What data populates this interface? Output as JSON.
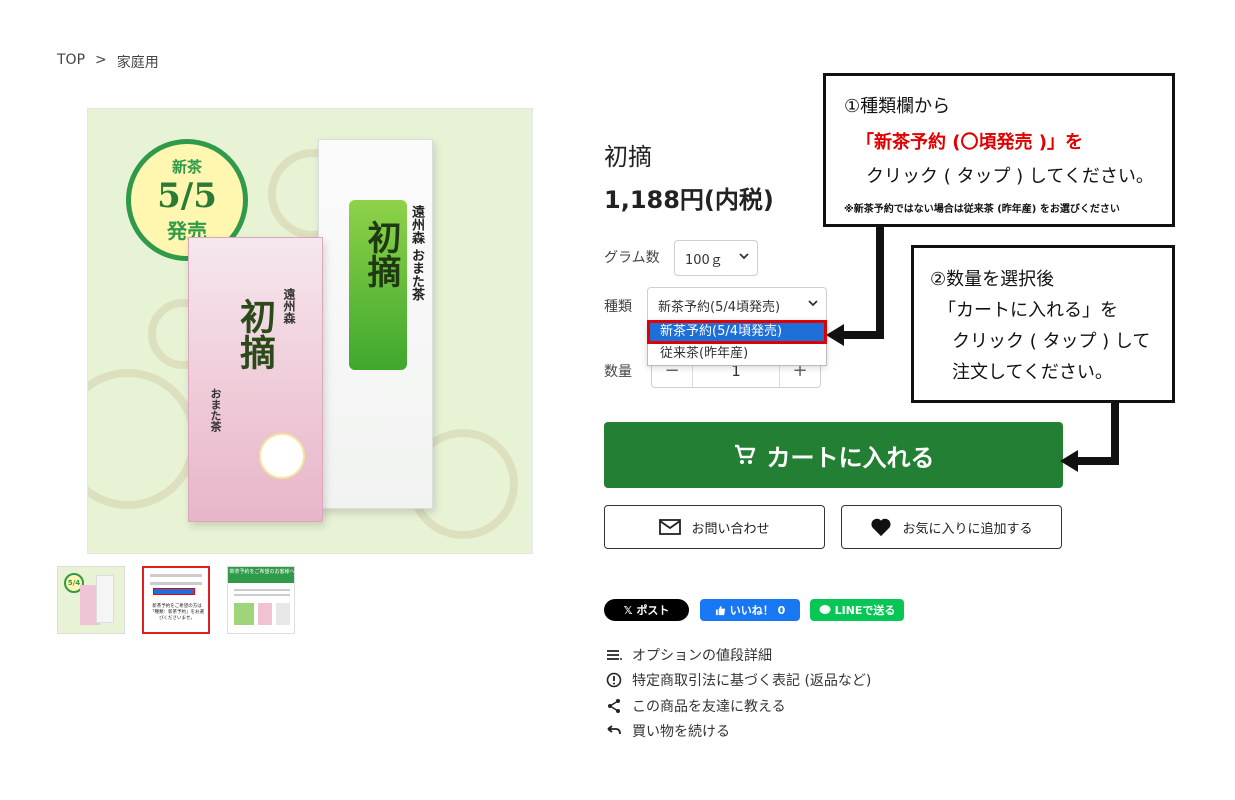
{
  "breadcrumb": {
    "top": "TOP",
    "sep": ">",
    "current": "家庭用"
  },
  "badge": {
    "line1": "新茶",
    "line2": "5/5",
    "line3": "発売"
  },
  "package": {
    "pink_title": "初摘",
    "pink_sub": "遠州森",
    "white_title": "初摘",
    "white_sub": "遠州森 おまた茶",
    "brand": "おまた茶"
  },
  "thumbnails": [
    {
      "label": "product-main",
      "badge": "5/4"
    },
    {
      "label": "order-guide",
      "text": "新茶予約をご希望の方は「種類：新茶予約」をお選びくださいませ。"
    },
    {
      "label": "new-tea-info",
      "title": "新茶予約をご希望のお客様へ"
    }
  ],
  "product": {
    "title": "初摘",
    "price": "1,188円(内税)"
  },
  "options": {
    "gram_label": "グラム数",
    "gram_value": "100ｇ",
    "type_label": "種類",
    "type_value": "新茶予約(5/4頃発売)",
    "type_options": [
      "新茶予約(5/4頃発売)",
      "従来茶(昨年産)"
    ],
    "qty_label": "数量",
    "qty_minus": "−",
    "qty_value": "1",
    "qty_plus": "+"
  },
  "buttons": {
    "cart": "カートに入れる",
    "inquiry": "お問い合わせ",
    "favorite": "お気に入りに追加する"
  },
  "share": {
    "x": "ポスト",
    "fb": "いいね！ 0",
    "line": "LINEで送る"
  },
  "links": [
    "オプションの値段詳細",
    "特定商取引法に基づく表記 (返品など)",
    "この商品を友達に教える",
    "買い物を続ける"
  ],
  "callout1": {
    "line1": "①種類欄から",
    "line2": "「新茶予約 (〇頃発売 )」を",
    "line3": "クリック ( タップ ) してください。",
    "note": "※新茶予約ではない場合は従来茶 (昨年産) をお選びください"
  },
  "callout2": {
    "line1": "②数量を選択後",
    "line2": "「カートに入れる」を",
    "line3": "クリック ( タップ ) して",
    "line4": "注文してください。"
  },
  "colors": {
    "cart_green": "#237f33",
    "highlight_red": "#e00000",
    "select_blue": "#1e6fd9",
    "badge_green": "#2f9a4a"
  }
}
